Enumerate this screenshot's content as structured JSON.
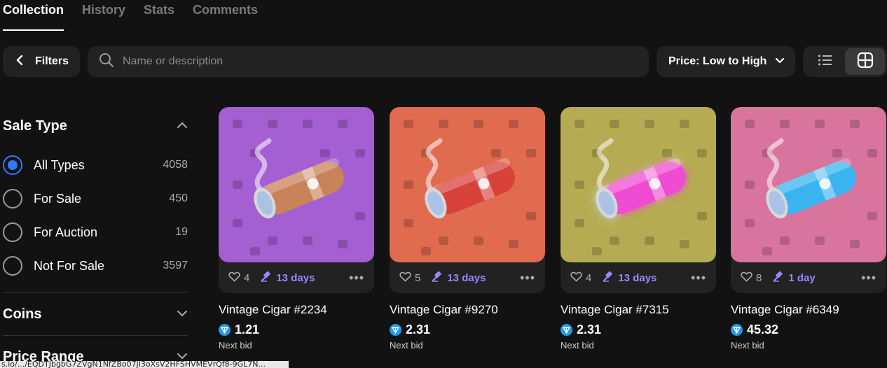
{
  "tabs": [
    {
      "label": "Collection",
      "active": true
    },
    {
      "label": "History",
      "active": false
    },
    {
      "label": "Stats",
      "active": false
    },
    {
      "label": "Comments",
      "active": false
    }
  ],
  "toolbar": {
    "filters_label": "Filters",
    "search_placeholder": "Name or description",
    "search_value": "",
    "sort_label": "Price: Low to High"
  },
  "sidebar": {
    "sale_type_title": "Sale Type",
    "sale_types": [
      {
        "label": "All Types",
        "count": "4058",
        "checked": true
      },
      {
        "label": "For Sale",
        "count": "450",
        "checked": false
      },
      {
        "label": "For Auction",
        "count": "19",
        "checked": false
      },
      {
        "label": "Not For Sale",
        "count": "3597",
        "checked": false
      }
    ],
    "coins_title": "Coins",
    "price_range_title": "Price Range"
  },
  "cards": [
    {
      "name": "Vintage Cigar #2234",
      "likes": "4",
      "auction": "13 days",
      "price": "1.21",
      "price_label": "Next bid",
      "bg": "#a45fd3",
      "cigar": "#c9825a",
      "glow": false
    },
    {
      "name": "Vintage Cigar #9270",
      "likes": "5",
      "auction": "13 days",
      "price": "2.31",
      "price_label": "Next bid",
      "bg": "#e06b4e",
      "cigar": "#d8423b",
      "glow": false
    },
    {
      "name": "Vintage Cigar #7315",
      "likes": "4",
      "auction": "13 days",
      "price": "2.31",
      "price_label": "Next bid",
      "bg": "#b5ab52",
      "cigar": "#f04cd3",
      "glow": true
    },
    {
      "name": "Vintage Cigar #6349",
      "likes": "8",
      "auction": "1 day",
      "price": "45.32",
      "price_label": "Next bid",
      "bg": "#d9749d",
      "cigar": "#3ab4f0",
      "glow": false
    }
  ],
  "status_url": "s.io/.../EQDTJbgbG7ZVgN1NfZBo07jI3oXsV2HFSHVMEVrQf8-9GL7N..."
}
